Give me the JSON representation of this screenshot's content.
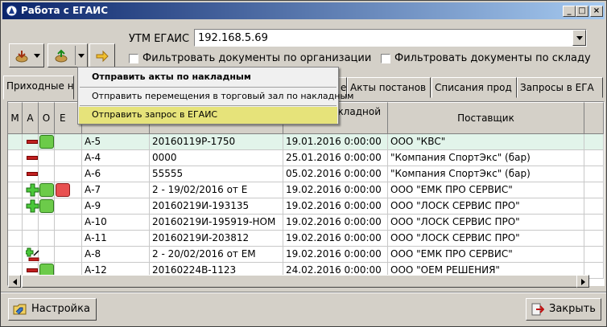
{
  "window": {
    "title": "Работа с ЕГАИС",
    "controls": {
      "minimize": "_",
      "maximize": "□",
      "close": "×"
    }
  },
  "utm": {
    "label": "УТМ ЕГАИС",
    "value": "192.168.5.69"
  },
  "filters": {
    "by_org": "Фильтровать документы по организации",
    "by_warehouse": "Фильтровать документы по складу"
  },
  "tabs": [
    "Приходные н",
    "е",
    "Акты постанов",
    "Списания прод",
    "Запросы в ЕГА"
  ],
  "menu": {
    "items": [
      "Отправить акты по накладным",
      "Отправить перемещения в торговый зал по накладным",
      "Отправить запрос в ЕГАИС"
    ],
    "highlight_color": "#e6e37a"
  },
  "table": {
    "headers": [
      "М",
      "А",
      "О",
      "Е",
      "",
      "",
      "кладной",
      "Поставщик"
    ],
    "rows": [
      {
        "num": "А-5",
        "doc": "20160119Р-1750",
        "date": "19.01.2016 0:00:00",
        "supplier": "ООО \"КВС\""
      },
      {
        "num": "А-4",
        "doc": "0000",
        "date": "25.01.2016 0:00:00",
        "supplier": "\"Компания СпортЭкс\" (бар)"
      },
      {
        "num": "А-6",
        "doc": "55555",
        "date": "05.02.2016 0:00:00",
        "supplier": "\"Компания СпортЭкс\" (бар)"
      },
      {
        "num": "А-7",
        "doc": "2  - 19/02/2016 от Е",
        "date": "19.02.2016 0:00:00",
        "supplier": "ООО \"ЕМК ПРО СЕРВИС\""
      },
      {
        "num": "А-9",
        "doc": "20160219И-193135",
        "date": "19.02.2016 0:00:00",
        "supplier": "ООО \"ЛОСК СЕРВИС ПРО\""
      },
      {
        "num": "А-10",
        "doc": "20160219И-195919-НОМ",
        "date": "19.02.2016 0:00:00",
        "supplier": "ООО \"ЛОСК СЕРВИС ПРО\""
      },
      {
        "num": "А-11",
        "doc": "20160219И-203812",
        "date": "19.02.2016 0:00:00",
        "supplier": "ООО \"ЛОСК СЕРВИС ПРО\""
      },
      {
        "num": "А-8",
        "doc": "2 - 20/02/2016 от ЕМ",
        "date": "19.02.2016 0:00:00",
        "supplier": "ООО \"ЕМК ПРО СЕРВИС\""
      },
      {
        "num": "А-12",
        "doc": "20160224В-1123",
        "date": "24.02.2016 0:00:00",
        "supplier": "ООО \"ОЕМ РЕШЕНИЯ\""
      }
    ],
    "selected_row_color": "#e2f4ea"
  },
  "buttons": {
    "settings": "Настройка",
    "close": "Закрыть"
  }
}
